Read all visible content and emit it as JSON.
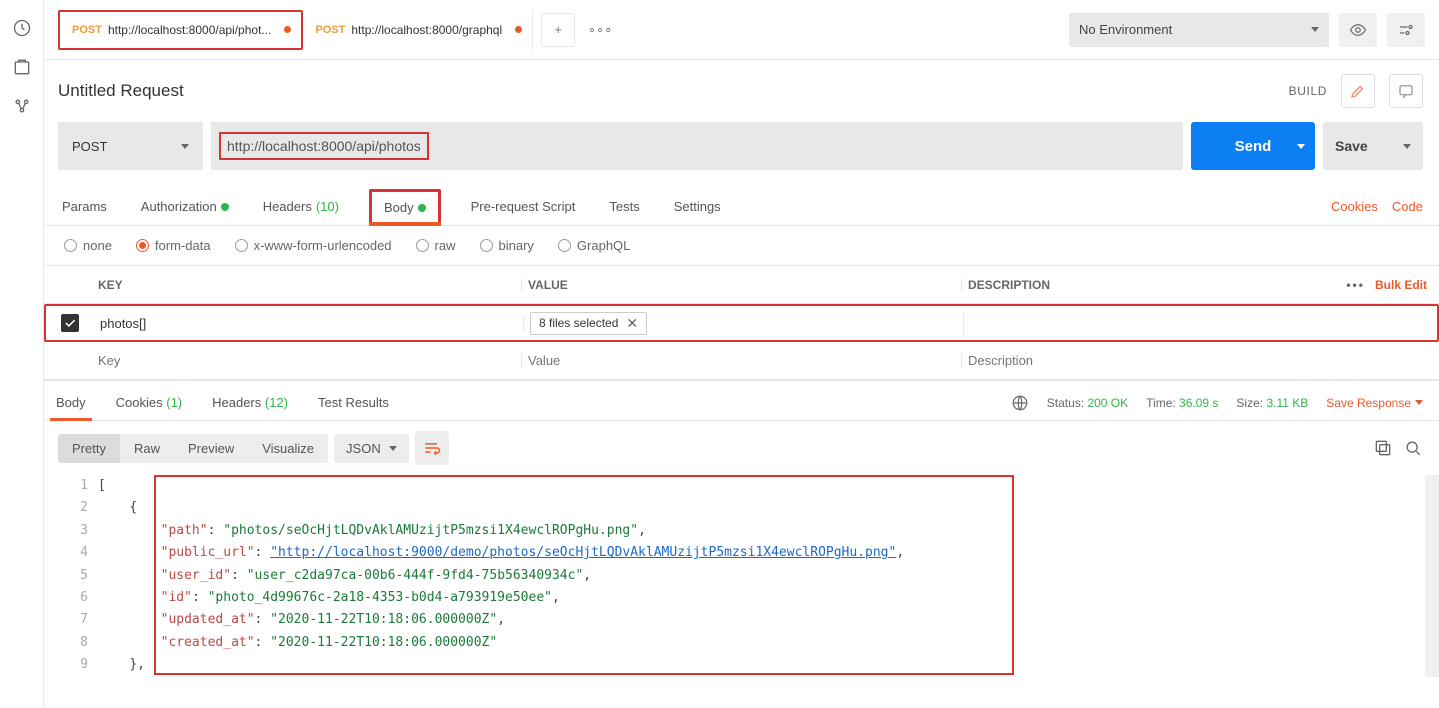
{
  "left_rail_icons": [
    "history-icon",
    "collections-icon",
    "apis-icon"
  ],
  "tabs": [
    {
      "method": "POST",
      "url": "http://localhost:8000/api/phot...",
      "dirty": true,
      "active": true
    },
    {
      "method": "POST",
      "url": "http://localhost:8000/graphql",
      "dirty": true,
      "active": false
    }
  ],
  "env": {
    "label": "No Environment"
  },
  "request": {
    "name": "Untitled Request",
    "build_label": "BUILD",
    "method": "POST",
    "url": "http://localhost:8000/api/photos",
    "send_label": "Send",
    "save_label": "Save"
  },
  "req_tabs": {
    "params": "Params",
    "auth": "Authorization",
    "headers": "Headers",
    "headers_count": "(10)",
    "body": "Body",
    "prerequest": "Pre-request Script",
    "tests": "Tests",
    "settings": "Settings",
    "cookies": "Cookies",
    "code": "Code"
  },
  "body_types": {
    "none": "none",
    "formdata": "form-data",
    "urlencoded": "x-www-form-urlencoded",
    "raw": "raw",
    "binary": "binary",
    "graphql": "GraphQL"
  },
  "kv": {
    "h_key": "KEY",
    "h_value": "VALUE",
    "h_desc": "DESCRIPTION",
    "bulk_edit": "Bulk Edit",
    "row_key": "photos[]",
    "row_value": "8 files selected",
    "ph_key": "Key",
    "ph_value": "Value",
    "ph_desc": "Description"
  },
  "resp_tabs": {
    "body": "Body",
    "cookies": "Cookies",
    "cookies_count": "(1)",
    "headers": "Headers",
    "headers_count": "(12)",
    "tests": "Test Results"
  },
  "resp_status": {
    "status_label": "Status:",
    "status_value": "200 OK",
    "time_label": "Time:",
    "time_value": "36.09 s",
    "size_label": "Size:",
    "size_value": "3.11 KB",
    "save_response": "Save Response"
  },
  "view": {
    "pretty": "Pretty",
    "raw": "Raw",
    "preview": "Preview",
    "visualize": "Visualize",
    "fmt": "JSON"
  },
  "response_body": {
    "lines": [
      "1",
      "2",
      "3",
      "4",
      "5",
      "6",
      "7",
      "8",
      "9"
    ],
    "l1": "[",
    "l2_indent": "    ",
    "l2": "{",
    "kv_indent": "        ",
    "k_path": "\"path\"",
    "v_path": "\"photos/seOcHjtLQDvAklAMUzijtP5mzsi1X4ewclROPgHu.png\"",
    "k_url": "\"public_url\"",
    "v_url": "\"http://localhost:9000/demo/photos/seOcHjtLQDvAklAMUzijtP5mzsi1X4ewclROPgHu.png\"",
    "k_uid": "\"user_id\"",
    "v_uid": "\"user_c2da97ca-00b6-444f-9fd4-75b56340934c\"",
    "k_id": "\"id\"",
    "v_id": "\"photo_4d99676c-2a18-4353-b0d4-a793919e50ee\"",
    "k_upd": "\"updated_at\"",
    "v_upd": "\"2020-11-22T10:18:06.000000Z\"",
    "k_crt": "\"created_at\"",
    "v_crt": "\"2020-11-22T10:18:06.000000Z\"",
    "l9": "},"
  }
}
